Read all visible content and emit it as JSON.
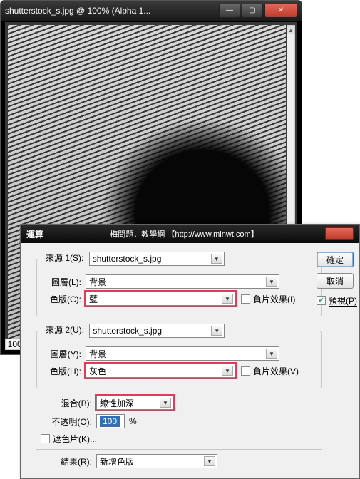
{
  "window": {
    "title": "shutterstock_s.jpg @ 100% (Alpha 1...",
    "zoom": "100%"
  },
  "dialog": {
    "title": "運算",
    "credit": "梅問題．教學網 【http://www.minwt.com】",
    "source1": {
      "legend": "來源 1(S):",
      "file": "shutterstock_s.jpg",
      "layer_label": "圖層(L):",
      "layer": "背景",
      "channel_label": "色版(C):",
      "channel": "藍",
      "invert_label": "負片效果(I)"
    },
    "source2": {
      "legend": "來源 2(U):",
      "file": "shutterstock_s.jpg",
      "layer_label": "圖層(Y):",
      "layer": "背景",
      "channel_label": "色版(H):",
      "channel": "灰色",
      "invert_label": "負片效果(V)"
    },
    "blend_label": "混合(B):",
    "blend": "線性加深",
    "opacity_label": "不透明(O):",
    "opacity": "100",
    "opacity_unit": "%",
    "mask_label": "遮色片(K)...",
    "result_label": "結果(R):",
    "result": "新增色版",
    "buttons": {
      "ok": "確定",
      "cancel": "取消",
      "preview": "預視(P)"
    }
  }
}
